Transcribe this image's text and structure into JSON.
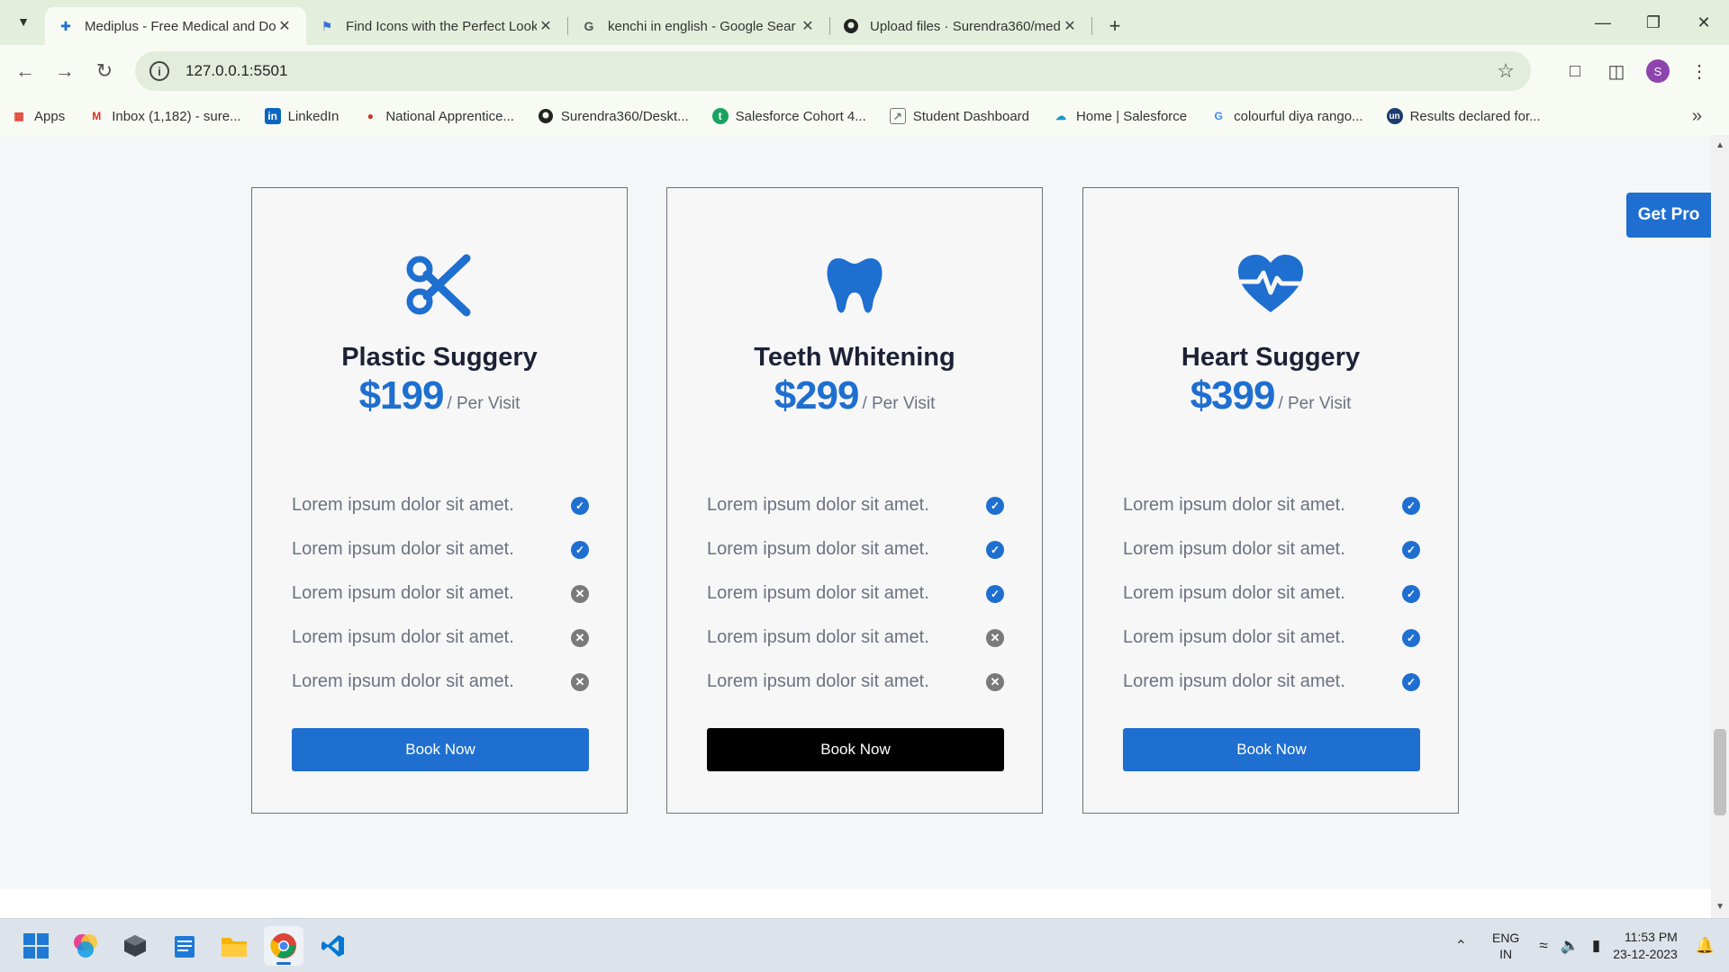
{
  "browser": {
    "tabs": [
      {
        "title": "Mediplus - Free Medical and Do",
        "favicon": "plus-icon",
        "active": true
      },
      {
        "title": "Find Icons with the Perfect Look",
        "favicon": "flag-icon",
        "active": false
      },
      {
        "title": "kenchi in english - Google Sear",
        "favicon": "google-icon",
        "active": false
      },
      {
        "title": "Upload files · Surendra360/med",
        "favicon": "github-icon",
        "active": false
      }
    ],
    "url": "127.0.0.1:5501",
    "bookmarks": [
      {
        "label": "Apps",
        "icon": "apps-grid-icon"
      },
      {
        "label": "Inbox (1,182) - sure...",
        "icon": "gmail-icon"
      },
      {
        "label": "LinkedIn",
        "icon": "linkedin-icon"
      },
      {
        "label": "National Apprentice...",
        "icon": "apprentice-icon"
      },
      {
        "label": "Surendra360/Deskt...",
        "icon": "github-icon"
      },
      {
        "label": "Salesforce Cohort 4...",
        "icon": "salesforce-cohort-icon"
      },
      {
        "label": "Student Dashboard",
        "icon": "dashboard-icon"
      },
      {
        "label": "Home | Salesforce",
        "icon": "salesforce-icon"
      },
      {
        "label": "colourful diya rango...",
        "icon": "google-icon"
      },
      {
        "label": "Results declared for...",
        "icon": "un-icon"
      }
    ]
  },
  "page": {
    "get_pro_label": "Get Pro",
    "cards": [
      {
        "name": "Plastic Suggery",
        "icon": "scissors-icon",
        "price": "$199",
        "per": "/ Per Visit",
        "features": [
          {
            "text": "Lorem ipsum dolor sit amet.",
            "included": true
          },
          {
            "text": "Lorem ipsum dolor sit amet.",
            "included": true
          },
          {
            "text": "Lorem ipsum dolor sit amet.",
            "included": false
          },
          {
            "text": "Lorem ipsum dolor sit amet.",
            "included": false
          },
          {
            "text": "Lorem ipsum dolor sit amet.",
            "included": false
          }
        ],
        "button_label": "Book Now",
        "button_color": "#1e6fd0"
      },
      {
        "name": "Teeth Whitening",
        "icon": "tooth-icon",
        "price": "$299",
        "per": "/ Per Visit",
        "features": [
          {
            "text": "Lorem ipsum dolor sit amet.",
            "included": true
          },
          {
            "text": "Lorem ipsum dolor sit amet.",
            "included": true
          },
          {
            "text": "Lorem ipsum dolor sit amet.",
            "included": true
          },
          {
            "text": "Lorem ipsum dolor sit amet.",
            "included": false
          },
          {
            "text": "Lorem ipsum dolor sit amet.",
            "included": false
          }
        ],
        "button_label": "Book Now",
        "button_color": "#000000"
      },
      {
        "name": "Heart Suggery",
        "icon": "heartbeat-icon",
        "price": "$399",
        "per": "/ Per Visit",
        "features": [
          {
            "text": "Lorem ipsum dolor sit amet.",
            "included": true
          },
          {
            "text": "Lorem ipsum dolor sit amet.",
            "included": true
          },
          {
            "text": "Lorem ipsum dolor sit amet.",
            "included": true
          },
          {
            "text": "Lorem ipsum dolor sit amet.",
            "included": true
          },
          {
            "text": "Lorem ipsum dolor sit amet.",
            "included": true
          }
        ],
        "button_label": "Book Now",
        "button_color": "#1e6fd0"
      }
    ]
  },
  "taskbar": {
    "lang_line1": "ENG",
    "lang_line2": "IN",
    "time": "11:53 PM",
    "date": "23-12-2023"
  },
  "colors": {
    "accent": "#1e6fd0",
    "muted": "#7a7a7a",
    "heading": "#1c2135"
  }
}
